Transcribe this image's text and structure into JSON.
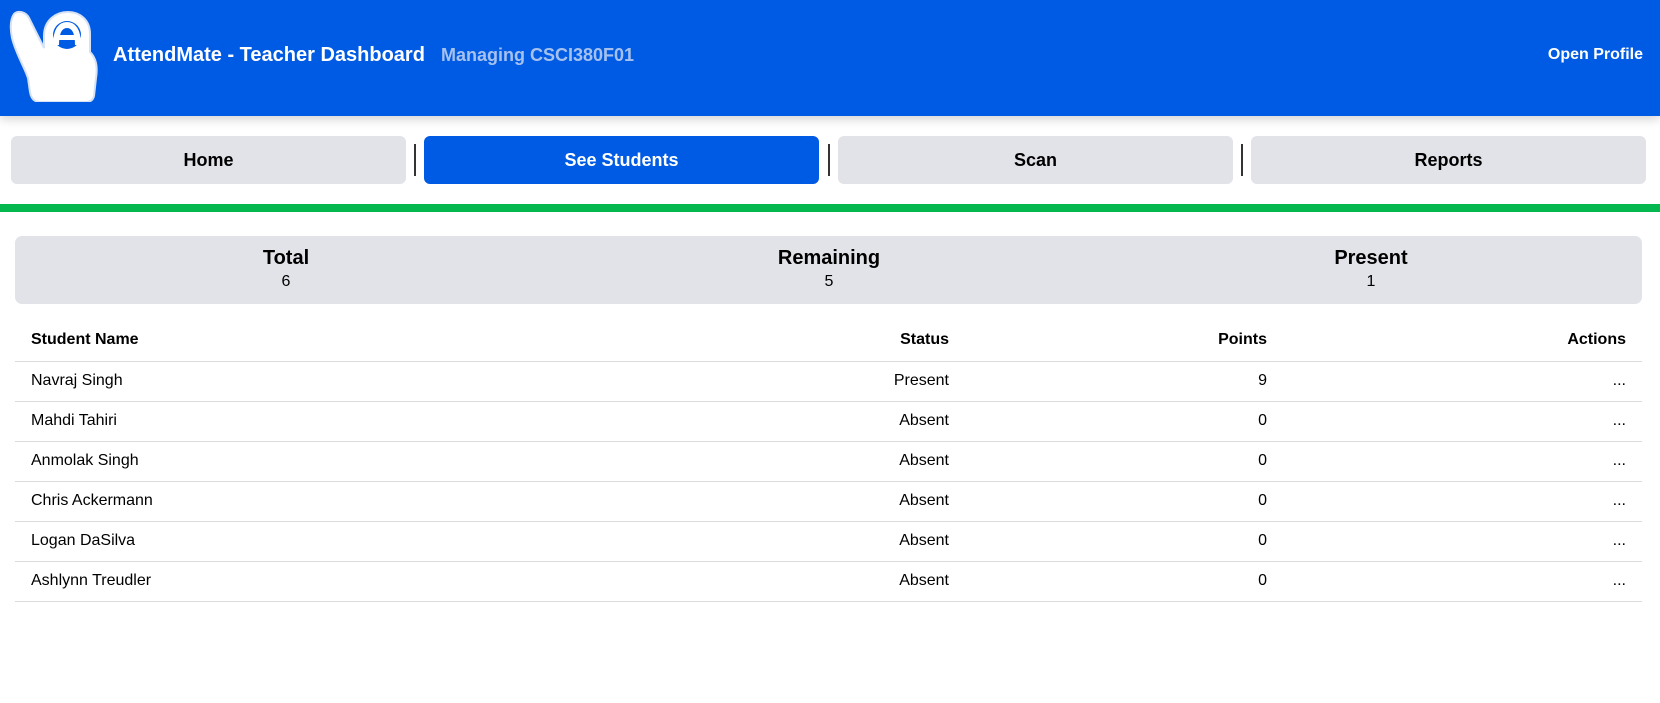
{
  "header": {
    "app_title": "AttendMate - Teacher Dashboard",
    "managing": "Managing CSCI380F01",
    "open_profile": "Open Profile",
    "logo_icon": "hand-raise-logo-icon"
  },
  "nav": {
    "tabs": [
      {
        "label": "Home",
        "active": false
      },
      {
        "label": "See Students",
        "active": true
      },
      {
        "label": "Scan",
        "active": false
      },
      {
        "label": "Reports",
        "active": false
      }
    ]
  },
  "summary": {
    "total": {
      "label": "Total",
      "value": "6"
    },
    "remaining": {
      "label": "Remaining",
      "value": "5"
    },
    "present": {
      "label": "Present",
      "value": "1"
    }
  },
  "table": {
    "headers": {
      "name": "Student Name",
      "status": "Status",
      "points": "Points",
      "actions": "Actions"
    },
    "rows": [
      {
        "name": "Navraj Singh",
        "status": "Present",
        "points": "9",
        "actions": "..."
      },
      {
        "name": "Mahdi Tahiri",
        "status": "Absent",
        "points": "0",
        "actions": "..."
      },
      {
        "name": "Anmolak Singh",
        "status": "Absent",
        "points": "0",
        "actions": "..."
      },
      {
        "name": "Chris Ackermann",
        "status": "Absent",
        "points": "0",
        "actions": "..."
      },
      {
        "name": "Logan DaSilva",
        "status": "Absent",
        "points": "0",
        "actions": "..."
      },
      {
        "name": "Ashlynn Treudler",
        "status": "Absent",
        "points": "0",
        "actions": "..."
      }
    ]
  },
  "colors": {
    "header_bg": "#005be4",
    "accent_green": "#04b84f",
    "tab_inactive": "#e2e3e8",
    "tab_active": "#005be4"
  }
}
